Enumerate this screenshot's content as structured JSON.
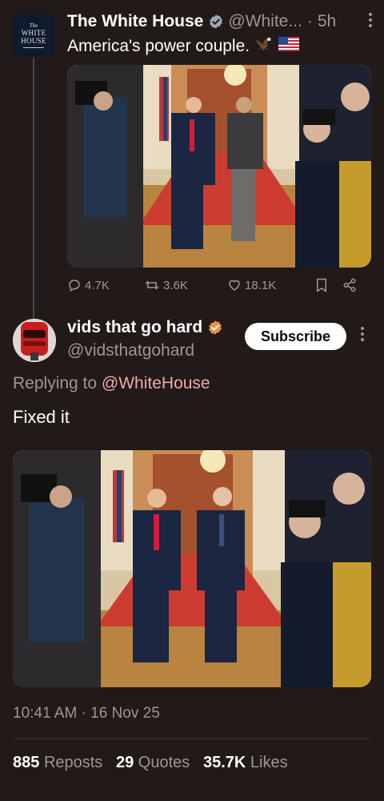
{
  "original_tweet": {
    "author_name": "The White House",
    "handle": "@White...",
    "separator": "·",
    "time_ago": "5h",
    "text": "America's power couple.",
    "emojis": [
      "eagle-emoji",
      "us-flag-emoji"
    ],
    "avatar": {
      "top": "The",
      "line1": "WHITE",
      "line2": "HOUSE"
    },
    "media_icon": "photo-east-room-hallway",
    "actions": {
      "replies": "4.7K",
      "reposts": "3.6K",
      "likes": "18.1K"
    }
  },
  "reply_tweet": {
    "author_name": "vids that go hard",
    "handle": "@vidsthatgohard",
    "subscribe_label": "Subscribe",
    "replying_prefix": "Replying to",
    "replying_to": "@WhiteHouse",
    "text": "Fixed it",
    "timestamp": "10:41 AM · 16 Nov 25",
    "stats": {
      "reposts_count": "885",
      "reposts_label": "Reposts",
      "quotes_count": "29",
      "quotes_label": "Quotes",
      "likes_count": "35.7K",
      "likes_label": "Likes"
    }
  },
  "colors": {
    "background": "#211a18",
    "verified": "#e8923f",
    "mention": "#f0a8a8",
    "muted": "#9d9794"
  }
}
